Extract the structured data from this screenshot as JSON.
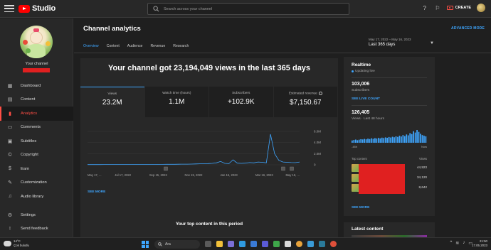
{
  "topbar": {
    "logo_text": "Studio",
    "search_placeholder": "Search across your channel",
    "create_label": "CREATE"
  },
  "sidebar": {
    "channel_label": "Your channel",
    "items": [
      {
        "label": "Dashboard",
        "icon": "dashboard-icon"
      },
      {
        "label": "Content",
        "icon": "content-icon"
      },
      {
        "label": "Analytics",
        "icon": "analytics-icon",
        "active": true
      },
      {
        "label": "Comments",
        "icon": "comments-icon"
      },
      {
        "label": "Subtitles",
        "icon": "subtitles-icon"
      },
      {
        "label": "Copyright",
        "icon": "copyright-icon"
      },
      {
        "label": "Earn",
        "icon": "earn-icon"
      },
      {
        "label": "Customization",
        "icon": "customization-icon"
      },
      {
        "label": "Audio library",
        "icon": "audio-library-icon"
      }
    ],
    "bottom_items": [
      {
        "label": "Settings",
        "icon": "gear-icon"
      },
      {
        "label": "Send feedback",
        "icon": "feedback-icon"
      }
    ]
  },
  "main": {
    "title": "Channel analytics",
    "advanced_mode": "ADVANCED MODE",
    "tabs": [
      "Overview",
      "Content",
      "Audience",
      "Revenue",
      "Research"
    ],
    "active_tab": "Overview",
    "date_range": "May 17, 2022 – May 16, 2023",
    "date_label": "Last 365 days",
    "headline": "Your channel got 23,194,049 views in the last 365 days",
    "metrics": [
      {
        "label": "Views",
        "value": "23.2M",
        "active": true
      },
      {
        "label": "Watch time (hours)",
        "value": "1.1M"
      },
      {
        "label": "Subscribers",
        "value": "+102.9K"
      },
      {
        "label": "Estimated revenue",
        "value": "$7,150.67"
      }
    ],
    "see_more": "SEE MORE",
    "top_content_title": "Your top content in this period"
  },
  "chart_data": {
    "type": "line",
    "x_ticks": [
      "May 17, ...",
      "Jul 17, 2022",
      "Sep 15, 2022",
      "Nov 15, 2022",
      "Jan 15, 2023",
      "Mar 16, 2023",
      "May 16, ..."
    ],
    "y_ticks": [
      "6.0M",
      "4.0M",
      "2.0M",
      "0"
    ],
    "ylim": [
      0,
      6000000
    ],
    "series": [
      {
        "values": [
          40000,
          42000,
          45000,
          43000,
          46000,
          48000,
          50000,
          47000,
          52000,
          55000,
          53000,
          58000,
          60000,
          62000,
          65000,
          70000,
          68000,
          75000,
          80000,
          85000,
          90000,
          95000,
          100000,
          110000,
          120000,
          130000,
          150000,
          180000,
          200000,
          220000,
          250000,
          350000,
          600000,
          250000,
          200000,
          900000,
          300000,
          250000,
          300000,
          400000,
          350000,
          500000,
          450000,
          350000,
          5500000,
          2000000,
          800000,
          500000,
          450000,
          400000,
          380000,
          500000
        ]
      }
    ],
    "color": "#3ea6ff"
  },
  "realtime": {
    "title": "Realtime",
    "updating": "Updating live",
    "subscribers_value": "103,006",
    "subscribers_label": "Subscribers",
    "see_live_count": "SEE LIVE COUNT",
    "views_value": "126,405",
    "views_label": "Views · Last 48 hours",
    "axis_left": "-48h",
    "axis_right": "Now",
    "bars": [
      18,
      22,
      25,
      20,
      24,
      28,
      26,
      30,
      27,
      32,
      29,
      35,
      31,
      36,
      33,
      38,
      34,
      40,
      37,
      42,
      39,
      45,
      41,
      47,
      43,
      50,
      46,
      55,
      49,
      60,
      52,
      65,
      58,
      75,
      68,
      90,
      80,
      100,
      85,
      70,
      60,
      55,
      50
    ],
    "top_content_label": "Top content",
    "views_col_label": "Views",
    "top_content": [
      {
        "views": "44,923"
      },
      {
        "views": "34,120"
      },
      {
        "views": "8,642"
      }
    ],
    "see_more": "SEE MORE"
  },
  "latest": {
    "title": "Latest content"
  },
  "taskbar": {
    "temperature": "14°C",
    "weather": "Çok bulutlu",
    "search": "Ara",
    "time": "21:50",
    "date": "17.05.2023"
  }
}
